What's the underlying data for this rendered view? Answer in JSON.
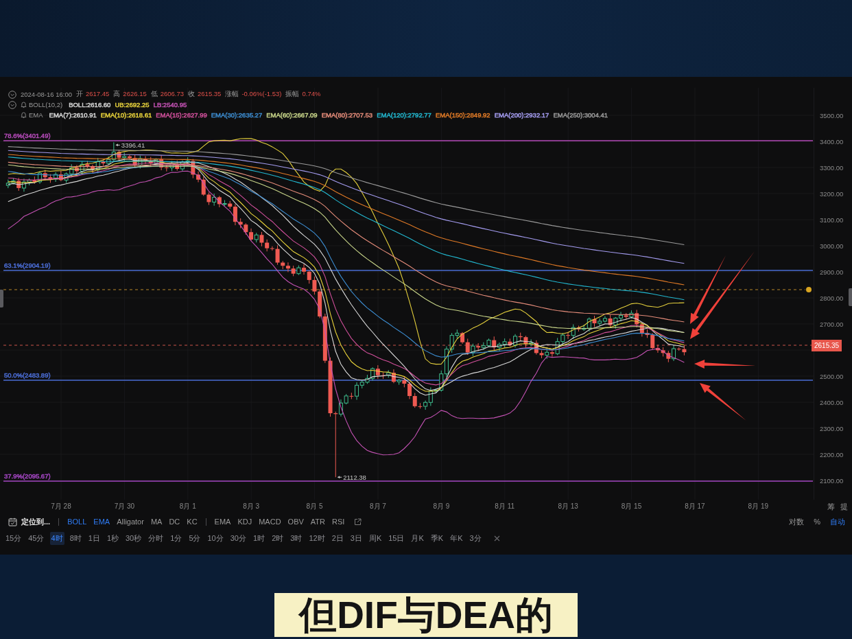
{
  "quote_bar": {
    "time": "2024-08-16 16:00",
    "fields": [
      {
        "label": "开",
        "value": "2617.45"
      },
      {
        "label": "高",
        "value": "2626.15"
      },
      {
        "label": "低",
        "value": "2606.73"
      },
      {
        "label": "收",
        "value": "2615.35"
      },
      {
        "label": "涨幅",
        "value": "-0.06%(-1.53)"
      },
      {
        "label": "振幅",
        "value": "0.74%"
      }
    ]
  },
  "boll_legend": {
    "title": "BOLL(10,2)",
    "items": [
      {
        "text": "BOLL:2616.60",
        "color": "#d6d6d6"
      },
      {
        "text": "UB:2692.25",
        "color": "#e4cf3c"
      },
      {
        "text": "LB:2540.95",
        "color": "#c452b4"
      }
    ]
  },
  "ema_legend": {
    "title": "EMA",
    "items": [
      {
        "text": "EMA(7):2610.91",
        "color": "#d9d9d9"
      },
      {
        "text": "EMA(10):2618.61",
        "color": "#e8d23a"
      },
      {
        "text": "EMA(15):2627.99",
        "color": "#d2509c"
      },
      {
        "text": "EMA(30):2635.27",
        "color": "#3c8cd0"
      },
      {
        "text": "EMA(60):2667.09",
        "color": "#c9d68a"
      },
      {
        "text": "EMA(80):2707.53",
        "color": "#e58c7a"
      },
      {
        "text": "EMA(120):2792.77",
        "color": "#22b8d0"
      },
      {
        "text": "EMA(150):2849.92",
        "color": "#e07a26"
      },
      {
        "text": "EMA(200):2932.17",
        "color": "#a49cf0"
      },
      {
        "text": "EMA(250):3004.41",
        "color": "#9a9a9a"
      }
    ]
  },
  "fib_levels": [
    {
      "label": "78.6%(3401.49)",
      "color": "#b44ab8"
    },
    {
      "label": "63.1%(2904.19)",
      "color": "#4a6cd4"
    },
    {
      "label": "50.0%(2483.89)",
      "color": "#4a6cd4"
    },
    {
      "label": "37.9%(2095.67)",
      "color": "#a346c2"
    }
  ],
  "extreme_labels": {
    "high": "3396.41",
    "low": "2112.38"
  },
  "price_axis": [
    {
      "kind": "tick",
      "label": "3500.00"
    },
    {
      "kind": "tick",
      "label": "3400.00"
    },
    {
      "kind": "tick",
      "label": "3300.00"
    },
    {
      "kind": "tick",
      "label": "3200.00"
    },
    {
      "kind": "tick",
      "label": "3100.00"
    },
    {
      "kind": "tick",
      "label": "3000.00"
    },
    {
      "kind": "tick",
      "label": "2900.00"
    },
    {
      "kind": "tick",
      "label": "2800.00"
    },
    {
      "kind": "tick",
      "label": "2700.00"
    },
    {
      "kind": "price",
      "label": "2615.35"
    },
    {
      "kind": "tick",
      "label": "2500.00"
    },
    {
      "kind": "tick",
      "label": "2400.00"
    },
    {
      "kind": "tick",
      "label": "2300.00"
    },
    {
      "kind": "tick",
      "label": "2200.00"
    },
    {
      "kind": "tick",
      "label": "2100.00"
    }
  ],
  "date_axis": {
    "dates": [
      "7月 28",
      "7月 30",
      "8月 1",
      "8月 3",
      "8月 5",
      "8月 7",
      "8月 9",
      "8月 11",
      "8月 13",
      "8月 15",
      "8月 17",
      "8月 19"
    ],
    "corner": [
      "筹",
      "提"
    ]
  },
  "indicator_bar": {
    "locate": "定位到...",
    "main": [
      {
        "label": "BOLL",
        "selected": true
      },
      {
        "label": "EMA",
        "selected": true
      },
      {
        "label": "Alligator",
        "selected": false
      },
      {
        "label": "MA",
        "selected": false
      },
      {
        "label": "DC",
        "selected": false
      },
      {
        "label": "KC",
        "selected": false
      }
    ],
    "sub": [
      {
        "label": "EMA",
        "selected": false
      },
      {
        "label": "KDJ",
        "selected": false
      },
      {
        "label": "MACD",
        "selected": false
      },
      {
        "label": "OBV",
        "selected": false
      },
      {
        "label": "ATR",
        "selected": false
      },
      {
        "label": "RSI",
        "selected": false
      }
    ],
    "scale": [
      {
        "label": "对数",
        "selected": false
      },
      {
        "label": "%",
        "selected": false
      },
      {
        "label": "自动",
        "selected": true
      }
    ]
  },
  "interval_bar": [
    {
      "label": "15分",
      "selected": false
    },
    {
      "label": "45分",
      "selected": false
    },
    {
      "label": "4时",
      "selected": true
    },
    {
      "label": "8时",
      "selected": false
    },
    {
      "label": "1日",
      "selected": false
    },
    {
      "label": "1秒",
      "selected": false
    },
    {
      "label": "30秒",
      "selected": false
    },
    {
      "label": "分时",
      "selected": false
    },
    {
      "label": "1分",
      "selected": false
    },
    {
      "label": "5分",
      "selected": false
    },
    {
      "label": "10分",
      "selected": false
    },
    {
      "label": "30分",
      "selected": false
    },
    {
      "label": "1时",
      "selected": false
    },
    {
      "label": "2时",
      "selected": false
    },
    {
      "label": "3时",
      "selected": false
    },
    {
      "label": "12时",
      "selected": false
    },
    {
      "label": "2日",
      "selected": false
    },
    {
      "label": "3日",
      "selected": false
    },
    {
      "label": "周K",
      "selected": false
    },
    {
      "label": "15日",
      "selected": false
    },
    {
      "label": "月K",
      "selected": false
    },
    {
      "label": "季K",
      "selected": false
    },
    {
      "label": "年K",
      "selected": false
    },
    {
      "label": "3分",
      "selected": false
    }
  ],
  "caption": "但DIF与DEA的"
}
